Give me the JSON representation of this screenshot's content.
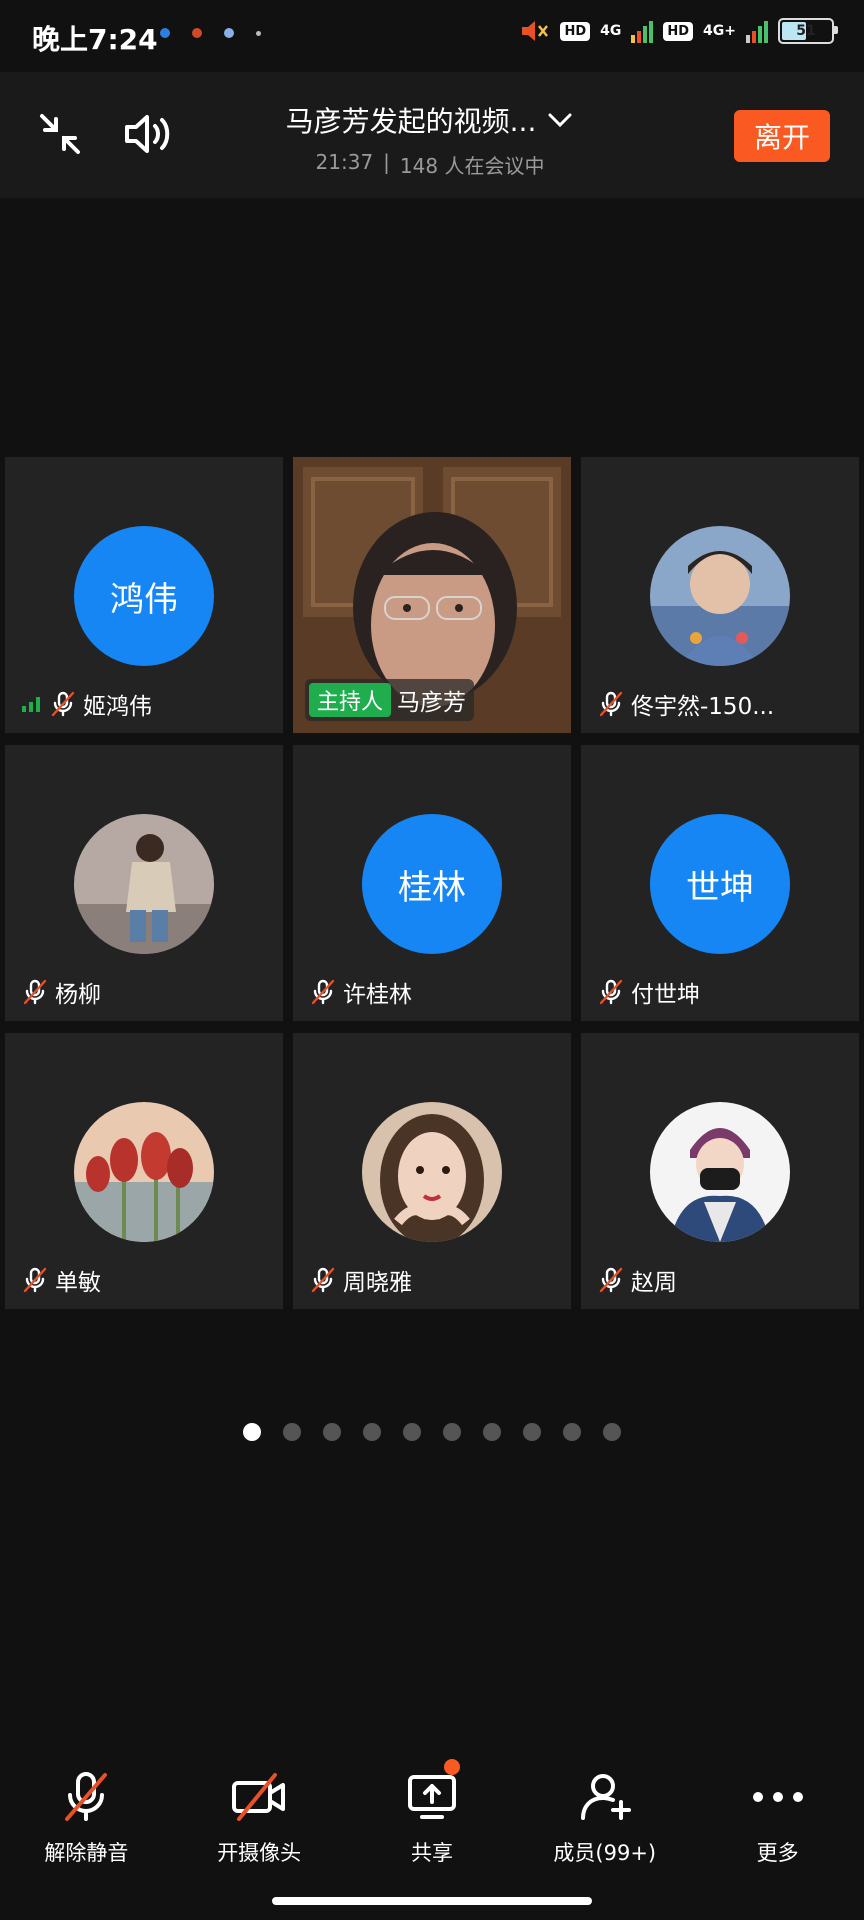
{
  "status_bar": {
    "time": "晚上7:24",
    "network1": "4G",
    "network2": "4G+",
    "hd": "HD",
    "battery": "51"
  },
  "header": {
    "title": "马彦芳发起的视频...",
    "duration": "21:37",
    "separator": "|",
    "participants": "148 人在会议中",
    "leave_label": "离开"
  },
  "tiles": [
    {
      "name": "姬鸿伟",
      "avatar_text": "鸿伟",
      "avatar_type": "text"
    },
    {
      "name": "马彦芳",
      "host_badge": "主持人",
      "avatar_type": "video"
    },
    {
      "name": "佟宇然-150...",
      "avatar_type": "photo"
    },
    {
      "name": "杨柳",
      "avatar_type": "photo"
    },
    {
      "name": "许桂林",
      "avatar_text": "桂林",
      "avatar_type": "text"
    },
    {
      "name": "付世坤",
      "avatar_text": "世坤",
      "avatar_type": "text"
    },
    {
      "name": "单敏",
      "avatar_type": "photo"
    },
    {
      "name": "周晓雅",
      "avatar_type": "photo"
    },
    {
      "name": "赵周",
      "avatar_type": "photo"
    }
  ],
  "pagination": {
    "total": 10,
    "current": 1
  },
  "toolbar": [
    {
      "label": "解除静音",
      "icon": "mic-muted-icon"
    },
    {
      "label": "开摄像头",
      "icon": "camera-off-icon"
    },
    {
      "label": "共享",
      "icon": "share-screen-icon"
    },
    {
      "label": "成员(99+)",
      "icon": "add-member-icon"
    },
    {
      "label": "更多",
      "icon": "more-icon"
    }
  ],
  "colors": {
    "accent": "#1686f5",
    "leave": "#fa5a22",
    "host": "#1fad4e",
    "muted": "#e8502a"
  }
}
